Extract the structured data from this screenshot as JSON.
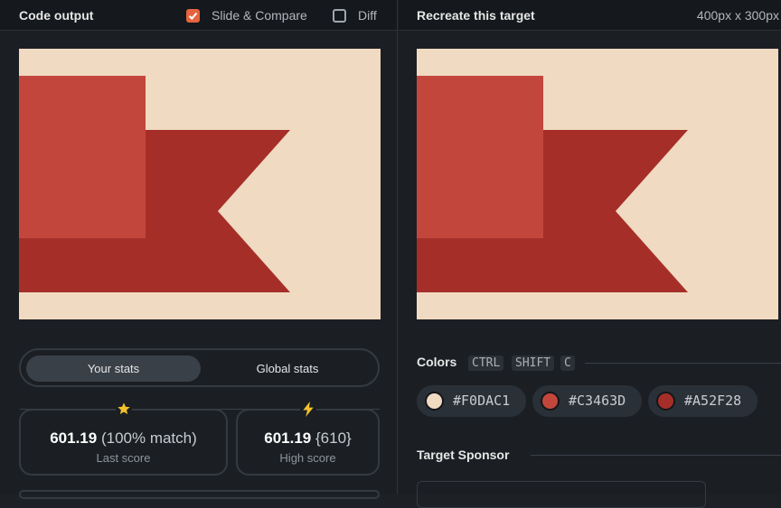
{
  "left_panel": {
    "title": "Code output",
    "slide_compare": {
      "label": "Slide & Compare",
      "checked": true
    },
    "diff": {
      "label": "Diff",
      "checked": false
    },
    "stats_tabs": [
      {
        "label": "Your stats"
      },
      {
        "label": "Global stats"
      }
    ],
    "last_score": {
      "value": "601.19",
      "match": "(100% match)",
      "label": "Last score",
      "icon": "star-icon"
    },
    "high_score": {
      "value": "601.19",
      "best": "{610}",
      "label": "High score",
      "icon": "lightning-icon"
    }
  },
  "right_panel": {
    "title": "Recreate this target",
    "dimensions": "400px x 300px",
    "colors_heading": "Colors",
    "shortcut_keys": [
      "CTRL",
      "SHIFT",
      "C"
    ],
    "colors": [
      {
        "hex": "#F0DAC1",
        "label": "#F0DAC1"
      },
      {
        "hex": "#C3463D",
        "label": "#C3463D"
      },
      {
        "hex": "#A52F28",
        "label": "#A52F28"
      }
    ],
    "sponsor_heading": "Target Sponsor"
  },
  "palette": {
    "accent": "#e5643f",
    "star": "#f2c22c"
  }
}
